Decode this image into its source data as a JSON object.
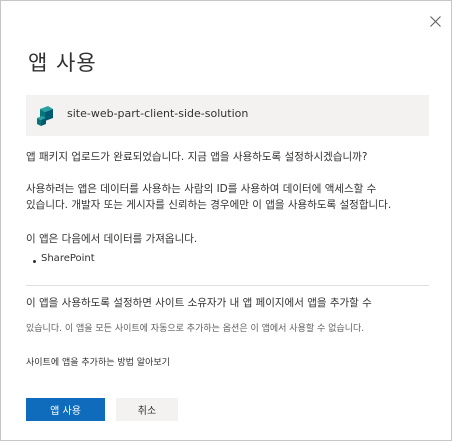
{
  "dialog": {
    "title": "앱 사용",
    "close_icon": "close-icon",
    "solution": {
      "icon": "solution-package-icon",
      "name": "site-web-part-client-side-solution"
    },
    "upload_message": "앱 패키지 업로드가 완료되었습니다. 지금 앱을 사용하도록 설정하시겠습니까?",
    "trust_message_line1": "사용하려는 앱은 데이터를 사용하는 사람의 ID를 사용하여 데이터에 액세스할 수",
    "trust_message_line2": "있습니다. 개발자 또는 게시자를 신뢰하는 경우에만 이 앱을 사용하도록 설정합니다.",
    "data_source_heading": "이 앱은 다음에서 데이터를 가져옵니다.",
    "data_sources": [
      "SharePoint"
    ],
    "owner_message_line1": "이 앱을 사용하도록 설정하면 사이트 소유자가 내 앱 페이지에서 앱을 추가할 수",
    "owner_message_line2": "있습니다. 이 앱을 모든 사이트에 자동으로 추가하는 옵션은 이 앱에서 사용할 수 없습니다.",
    "learn_link": "사이트에 앱을 추가하는 방법 알아보기",
    "primary_button": "앱 사용",
    "secondary_button": "취소"
  },
  "colors": {
    "primary": "#0f6cbd",
    "icon_teal": "#038387",
    "box_background": "#f3f2f1"
  }
}
